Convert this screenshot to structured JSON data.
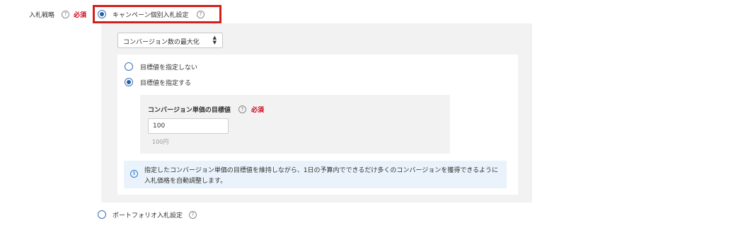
{
  "bid_strategy": {
    "label": "入札戦略",
    "help": "?",
    "required": "必須"
  },
  "options": {
    "campaign": {
      "label": "キャンペーン個別入札設定",
      "help": "?",
      "selected": true
    },
    "portfolio": {
      "label": "ポートフォリオ入札設定",
      "help": "?",
      "selected": false
    }
  },
  "strategy_select": {
    "value": "コンバージョン数の最大化",
    "arrows": "▲▼"
  },
  "target": {
    "no_target": {
      "label": "目標値を指定しない",
      "selected": false
    },
    "set_target": {
      "label": "目標値を指定する",
      "selected": true
    },
    "cpa_label": "コンバージョン単価の目標値",
    "cpa_help": "?",
    "cpa_required": "必須",
    "cpa_value": "100",
    "cpa_unit": "100円"
  },
  "info": {
    "icon": "i",
    "text": "指定したコンバージョン単価の目標値を維持しながら、1日の予算内でできるだけ多くのコンバージョンを獲得できるように入札価格を自動調整します。"
  },
  "colors": {
    "highlight": "#d2201c",
    "required": "#d0021b",
    "radio": "#1f5fa8",
    "info": "#2f7dd1"
  }
}
